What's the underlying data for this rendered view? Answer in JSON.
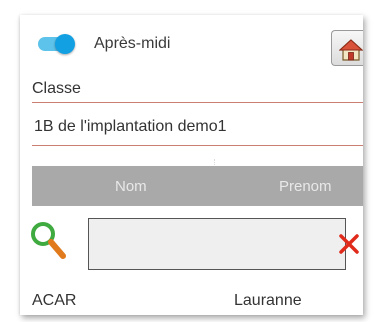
{
  "toggle": {
    "label": "Après-midi",
    "on": true
  },
  "toolbar": {
    "home_icon": "home-icon"
  },
  "classe": {
    "label": "Classe",
    "value": "1B de l'implantation demo1"
  },
  "table": {
    "columns": [
      "Nom",
      "Prenom"
    ],
    "rows": [
      {
        "nom": "ACAR",
        "prenom": "Lauranne"
      }
    ]
  },
  "search": {
    "value": "",
    "placeholder": "",
    "icon": "search-icon",
    "clear_icon": "close-icon"
  },
  "colors": {
    "accent": "#12a0e2",
    "underline": "#c98070",
    "header_bg": "#a9a9a9",
    "search_icon": "#3faa3f",
    "clear_icon": "#e02b1b"
  }
}
